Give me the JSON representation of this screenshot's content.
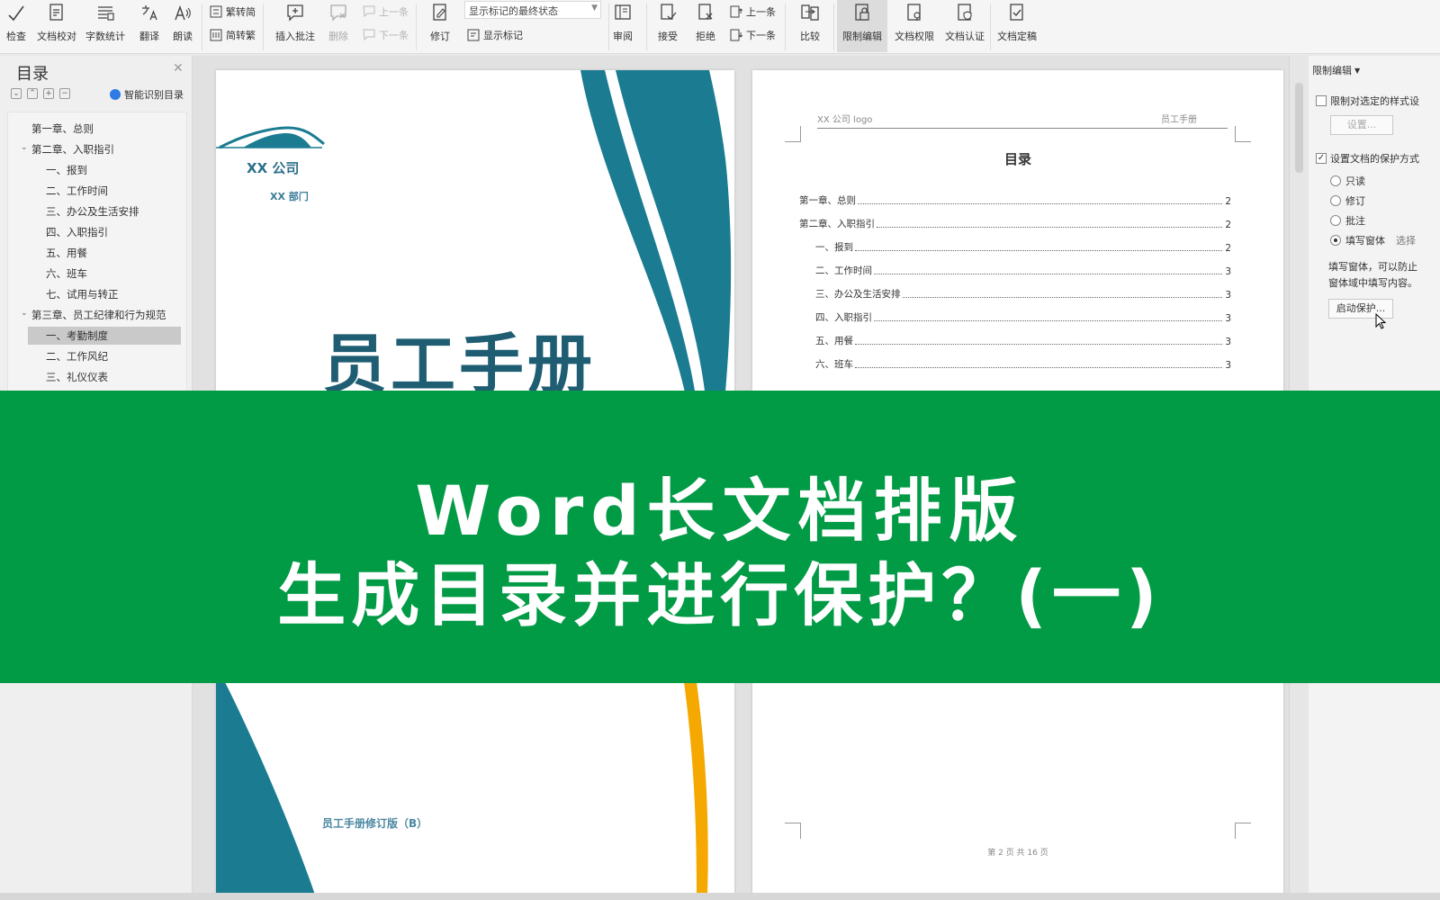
{
  "ribbon": {
    "buttons": [
      {
        "label": "检查",
        "icon": "spellcheck-icon"
      },
      {
        "label": "文档校对",
        "icon": "proofread-icon"
      },
      {
        "label": "字数统计",
        "icon": "word-count-icon"
      },
      {
        "label": "翻译",
        "icon": "translate-icon"
      },
      {
        "label": "朗读",
        "icon": "read-aloud-icon"
      },
      {
        "label": "插入批注",
        "icon": "insert-comment-icon"
      },
      {
        "label": "删除",
        "icon": "delete-comment-icon"
      },
      {
        "label": "修订",
        "icon": "track-changes-icon"
      },
      {
        "label": "审阅",
        "icon": "review-pane-icon"
      },
      {
        "label": "接受",
        "icon": "accept-icon"
      },
      {
        "label": "拒绝",
        "icon": "reject-icon"
      },
      {
        "label": "比较",
        "icon": "compare-icon"
      },
      {
        "label": "限制编辑",
        "icon": "restrict-editing-icon"
      },
      {
        "label": "文档权限",
        "icon": "document-permission-icon"
      },
      {
        "label": "文档认证",
        "icon": "document-certify-icon"
      },
      {
        "label": "文档定稿",
        "icon": "document-finalize-icon"
      }
    ],
    "trad_to_simp": "繁转简",
    "simp_to_trad": "简转繁",
    "prev_comment": "上一条",
    "next_comment": "下一条",
    "markup_state": "显示标记的最终状态",
    "show_markup": "显示标记",
    "prev_change": "上一条",
    "next_change": "下一条"
  },
  "nav": {
    "title": "目录",
    "smart_toc": "智能识别目录",
    "items": [
      {
        "label": "第一章、总则",
        "level": 1
      },
      {
        "label": "第二章、入职指引",
        "level": 1,
        "expanded": true
      },
      {
        "label": "一、报到",
        "level": 2
      },
      {
        "label": "二、工作时间",
        "level": 2
      },
      {
        "label": "三、办公及生活安排",
        "level": 2
      },
      {
        "label": "四、入职指引",
        "level": 2
      },
      {
        "label": "五、用餐",
        "level": 2
      },
      {
        "label": "六、班车",
        "level": 2
      },
      {
        "label": "七、试用与转正",
        "level": 2
      },
      {
        "label": "第三章、员工纪律和行为规范",
        "level": 1,
        "expanded": true
      },
      {
        "label": "一、考勤制度",
        "level": 2,
        "selected": true
      },
      {
        "label": "二、工作风纪",
        "level": 2
      },
      {
        "label": "三、礼仪仪表",
        "level": 2
      }
    ]
  },
  "cover": {
    "company": "XX 公司",
    "department": "XX 部门",
    "title": "员工手册",
    "footer": "员工手册修订版（B）"
  },
  "toc_page": {
    "header_left": "XX 公司 logo",
    "header_right": "员工手册",
    "heading": "目录",
    "entries": [
      {
        "text": "第一章、总则",
        "page": "2",
        "indent": 0
      },
      {
        "text": "第二章、入职指引",
        "page": "2",
        "indent": 0
      },
      {
        "text": "一、报到",
        "page": "2",
        "indent": 1
      },
      {
        "text": "二、工作时间",
        "page": "3",
        "indent": 1
      },
      {
        "text": "三、办公及生活安排",
        "page": "3",
        "indent": 1
      },
      {
        "text": "四、入职指引",
        "page": "3",
        "indent": 1
      },
      {
        "text": "五、用餐",
        "page": "3",
        "indent": 1
      },
      {
        "text": "六、班车",
        "page": "3",
        "indent": 1
      }
    ],
    "page_number": "第 2 页 共 16 页"
  },
  "restrict_panel": {
    "title": "限制编辑",
    "limit_format": "限制对选定的样式设",
    "settings_button": "设置...",
    "set_protection": "设置文档的保护方式",
    "options": [
      "只读",
      "修订",
      "批注",
      "填写窗体"
    ],
    "selected_option": "填写窗体",
    "option_extra": "选择",
    "description_line1": "填写窗体，可以防止",
    "description_line2": "窗体域中填写内容。",
    "start_button": "启动保护..."
  },
  "banner": {
    "line1": "Word长文档排版",
    "line2": "生成目录并进行保护？(一)"
  },
  "colors": {
    "banner_green": "#019a45",
    "teal": "#1a7b91",
    "dark_teal": "#1f5d72",
    "gold": "#f5a800"
  }
}
